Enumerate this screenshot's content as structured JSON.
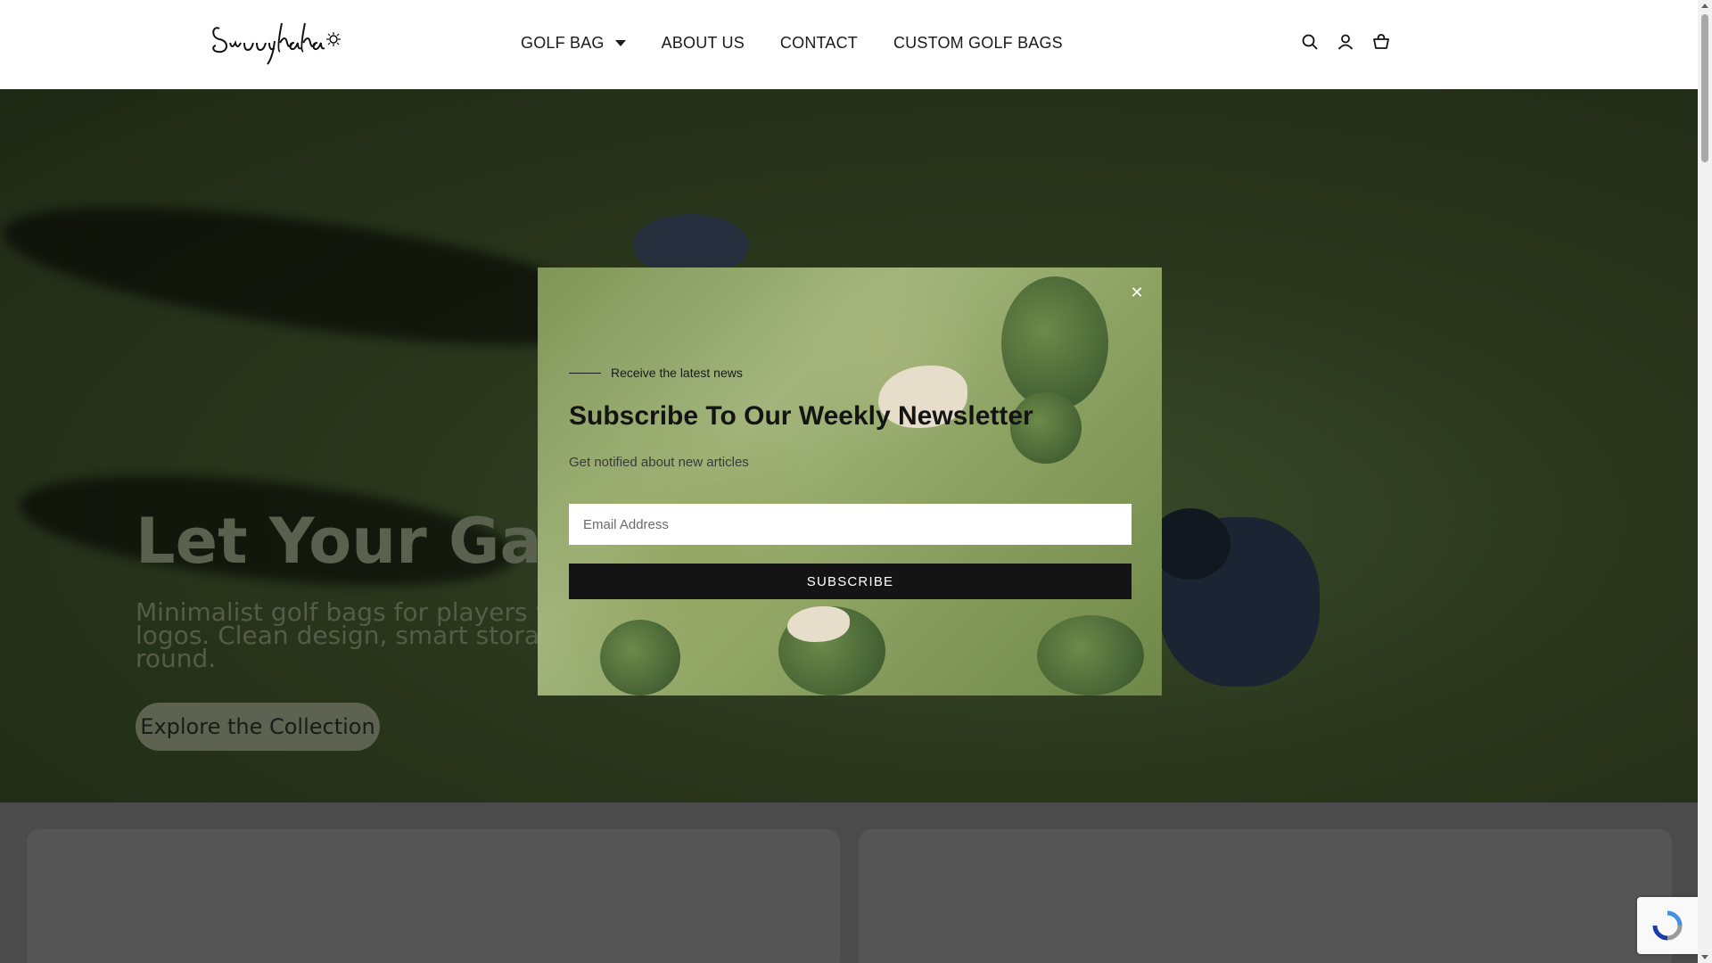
{
  "brand": {
    "logo_text": "Sunnyhaha"
  },
  "nav": {
    "items": [
      {
        "label": "GOLF BAG",
        "has_dropdown": true
      },
      {
        "label": "ABOUT US"
      },
      {
        "label": "CONTACT"
      },
      {
        "label": "CUSTOM GOLF BAGS"
      }
    ]
  },
  "header_icons": [
    "search-icon",
    "account-icon",
    "cart-icon"
  ],
  "hero": {
    "title": "Let Your Game",
    "subtitle_lines": [
      "Minimalist golf bags for players who",
      "logos. Clean design, smart storage,",
      "round."
    ],
    "cta_label": "Explore the Collection"
  },
  "modal": {
    "kicker": "Receive the latest news",
    "title": "Subscribe To Our Weekly Newsletter",
    "description": "Get notified about new articles",
    "email_placeholder": "Email Address",
    "button_label": "SUBSCRIBE",
    "close_symbol": "✕"
  },
  "colors": {
    "accent": "#141414",
    "overlay": "#1f2915",
    "header_bg": "#ffffff"
  }
}
